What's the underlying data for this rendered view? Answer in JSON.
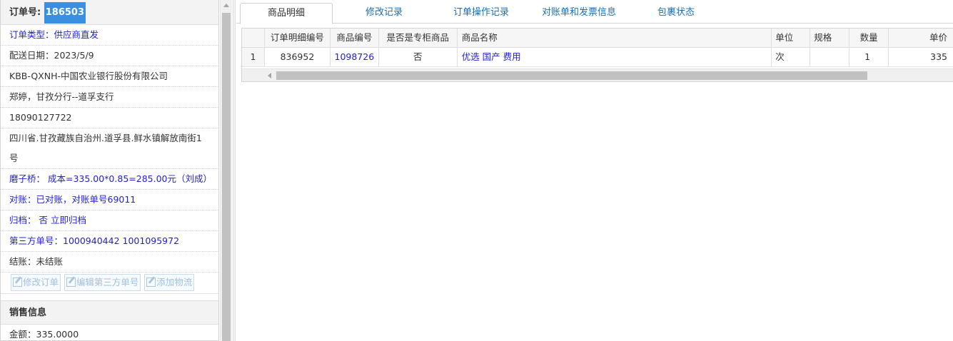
{
  "order": {
    "label": "订单号:",
    "number": "186503",
    "type": "订单类型：供应商直发",
    "delivery_date": "配送日期：2023/5/9",
    "company": "KBB-QXNH-中国农业银行股份有限公司",
    "contact": "郑婷，甘孜分行--道孚支行",
    "phone": "18090127722",
    "address_line1": "四川省.甘孜藏族自治州.道孚县.鲜水镇解放南街1",
    "address_line2": "号",
    "cost_note": "磨子桥： 成本=335.00*0.85=285.00元（刘成）",
    "reconcile": "对账：已对账，对账单号69011",
    "archive": "归档： 否 立即归档",
    "third_party": "第三方单号：1000940442 1001095972",
    "settlement": "结账：未结账"
  },
  "buttons": {
    "edit_order": "修改订单",
    "edit_third_party": "编辑第三方单号",
    "add_logistics": "添加物流"
  },
  "sales": {
    "header": "销售信息",
    "amount": "金额：335.0000"
  },
  "tabs": [
    {
      "label": "商品明细",
      "active": true
    },
    {
      "label": "修改记录",
      "active": false
    },
    {
      "label": "订单操作记录",
      "active": false
    },
    {
      "label": "对账单和发票信息",
      "active": false
    },
    {
      "label": "包裹状态",
      "active": false
    }
  ],
  "grid": {
    "headers": {
      "detail_no": "订单明细编号",
      "product_code": "商品编号",
      "special": "是否是专柜商品",
      "name": "商品名称",
      "unit": "单位",
      "spec": "规格",
      "qty": "数量",
      "price": "单价"
    },
    "rows": [
      {
        "index": "1",
        "detail_no": "836952",
        "product_code": "1098726",
        "special": "否",
        "name": "优选 国产 费用",
        "unit": "次",
        "spec": "",
        "qty": "1",
        "price": "335"
      }
    ]
  }
}
